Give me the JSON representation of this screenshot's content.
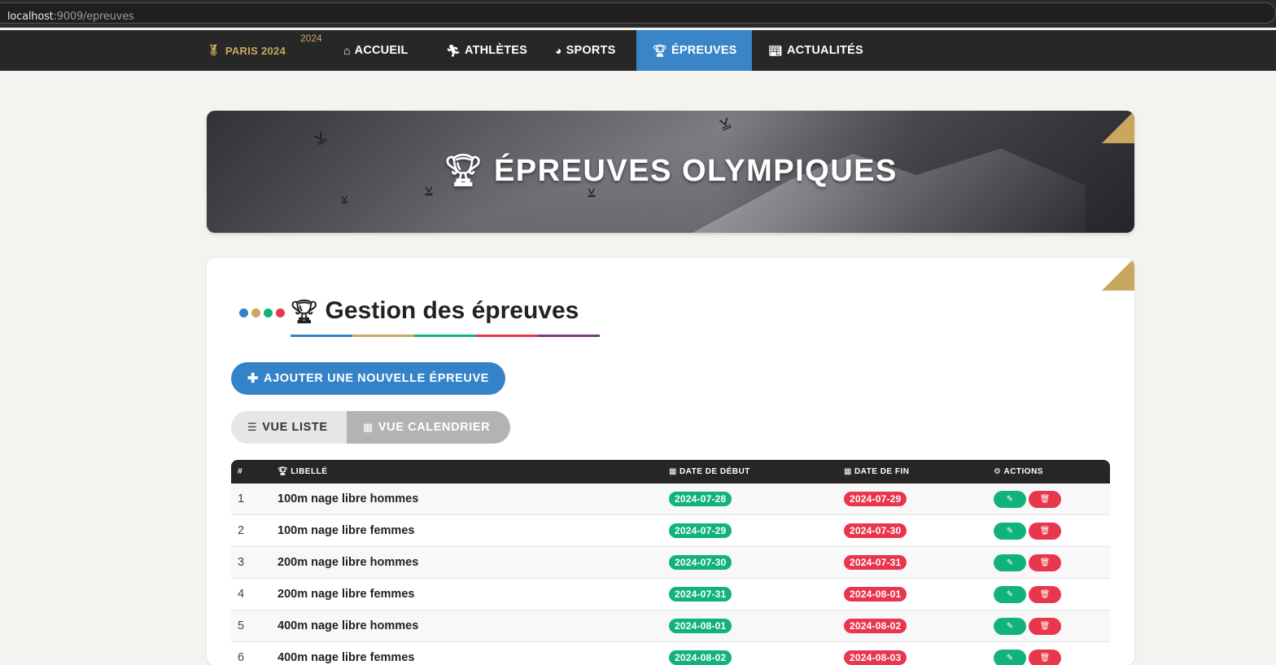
{
  "browser": {
    "url_host": "localhost",
    "url_path": ":9009/epreuves"
  },
  "nav": {
    "brand": "PARIS 2024",
    "brand_year": "2024",
    "items": [
      {
        "label": "ACCUEIL",
        "icon": "home-icon",
        "active": false
      },
      {
        "label": "ATHLÈTES",
        "icon": "runner-icon",
        "active": false
      },
      {
        "label": "SPORTS",
        "icon": "volleyball-icon",
        "active": false
      },
      {
        "label": "ÉPREUVES",
        "icon": "trophy-icon",
        "active": true
      },
      {
        "label": "ACTUALITÉS",
        "icon": "newspaper-icon",
        "active": false
      }
    ]
  },
  "hero": {
    "title": "ÉPREUVES OLYMPIQUES"
  },
  "section": {
    "title": "Gestion des épreuves",
    "add_button": "AJOUTER UNE NOUVELLE ÉPREUVE",
    "view_list": "VUE LISTE",
    "view_calendar": "VUE CALENDRIER"
  },
  "table": {
    "headers": {
      "num": "#",
      "label": "LIBELLÉ",
      "start": "DATE DE DÉBUT",
      "end": "DATE DE FIN",
      "actions": "ACTIONS"
    },
    "rows": [
      {
        "num": "1",
        "label": "100m nage libre hommes",
        "start": "2024-07-28",
        "end": "2024-07-29"
      },
      {
        "num": "2",
        "label": "100m nage libre femmes",
        "start": "2024-07-29",
        "end": "2024-07-30"
      },
      {
        "num": "3",
        "label": "200m nage libre hommes",
        "start": "2024-07-30",
        "end": "2024-07-31"
      },
      {
        "num": "4",
        "label": "200m nage libre femmes",
        "start": "2024-07-31",
        "end": "2024-08-01"
      },
      {
        "num": "5",
        "label": "400m nage libre hommes",
        "start": "2024-08-01",
        "end": "2024-08-02"
      },
      {
        "num": "6",
        "label": "400m nage libre femmes",
        "start": "2024-08-02",
        "end": "2024-08-03"
      }
    ]
  },
  "colors": {
    "accent_blue": "#3a85c8",
    "gold": "#c9a75f",
    "green": "#12b37a",
    "red": "#e8364d",
    "ring_colors": [
      "#3483c9",
      "#c9a75f",
      "#12b37a",
      "#e8364d",
      "#7b3b7e"
    ]
  }
}
